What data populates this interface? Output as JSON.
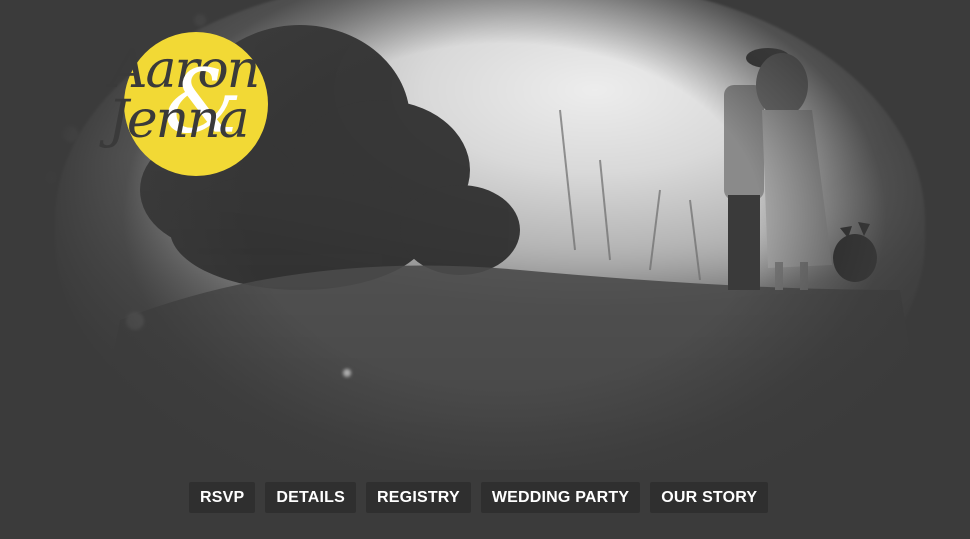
{
  "logo": {
    "first_name": "Aaron",
    "ampersand": "&",
    "second_name": "Jenna",
    "accent_color": "#f2d935"
  },
  "hero": {
    "style": "black-and-white photo with vignette",
    "icon": "couple-photo"
  },
  "nav": {
    "items": [
      {
        "label": "RSVP"
      },
      {
        "label": "DETAILS"
      },
      {
        "label": "REGISTRY"
      },
      {
        "label": "WEDDING PARTY"
      },
      {
        "label": "OUR STORY"
      }
    ]
  }
}
